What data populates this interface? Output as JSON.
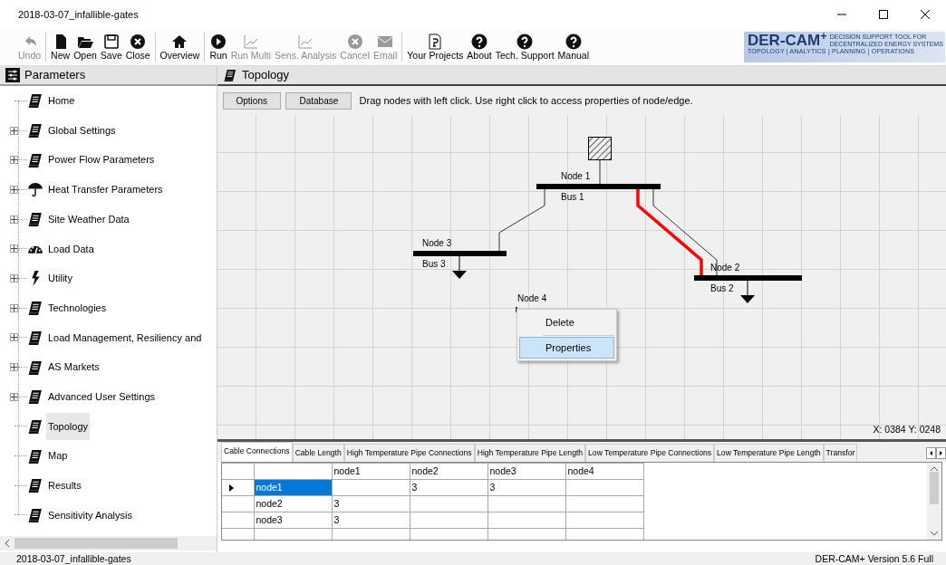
{
  "window": {
    "title": "2018-03-07_infallible-gates"
  },
  "toolbar": [
    [
      {
        "label": "Undo",
        "disabled": true
      }
    ],
    [
      {
        "label": "New",
        "disabled": false
      },
      {
        "label": "Open",
        "disabled": false
      },
      {
        "label": "Save",
        "disabled": false
      },
      {
        "label": "Close",
        "disabled": false
      }
    ],
    [
      {
        "label": "Overview",
        "disabled": false
      }
    ],
    [
      {
        "label": "Run",
        "disabled": false
      },
      {
        "label": "Run Multi",
        "disabled": true
      },
      {
        "label": "Sens. Analysis",
        "disabled": true
      },
      {
        "label": "Cancel",
        "disabled": true
      },
      {
        "label": "Email",
        "disabled": true
      }
    ],
    [
      {
        "label": "Your Projects",
        "disabled": false
      },
      {
        "label": "About",
        "disabled": false
      },
      {
        "label": "Tech. Support",
        "disabled": false
      },
      {
        "label": "Manual",
        "disabled": false
      }
    ]
  ],
  "logo": {
    "title": "DER-CAM$^{+}$",
    "tagline": [
      "DECISION SUPPORT TOOL FOR",
      "DECENTRALIZED ENERGY SYSTEMS"
    ],
    "footer": "TOPOLOGY | ANALYTICS | PLANNING | OPERATIONS"
  },
  "sidebar": {
    "title": "Parameters",
    "items": [
      {
        "label": "Home",
        "expandable": false,
        "selected": false
      },
      {
        "label": "Global Settings",
        "expandable": true,
        "selected": false
      },
      {
        "label": "Power Flow Parameters",
        "expandable": true,
        "selected": false
      },
      {
        "label": "Heat Transfer Parameters",
        "expandable": true,
        "selected": false
      },
      {
        "label": "Site Weather Data",
        "expandable": true,
        "selected": false
      },
      {
        "label": "Load Data",
        "expandable": true,
        "selected": false
      },
      {
        "label": "Utility",
        "expandable": true,
        "selected": false
      },
      {
        "label": "Technologies",
        "expandable": true,
        "selected": false
      },
      {
        "label": "Load Management, Resiliency and",
        "expandable": true,
        "selected": false
      },
      {
        "label": "AS Markets",
        "expandable": true,
        "selected": false
      },
      {
        "label": "Advanced User Settings",
        "expandable": true,
        "selected": false
      },
      {
        "label": "Topology",
        "expandable": false,
        "selected": true
      },
      {
        "label": "Map",
        "expandable": false,
        "selected": false
      },
      {
        "label": "Results",
        "expandable": false,
        "selected": false
      },
      {
        "label": "Sensitivity Analysis",
        "expandable": false,
        "selected": false
      }
    ]
  },
  "topology": {
    "title": "Topology",
    "buttons": [
      "Options",
      "Database"
    ],
    "hint": "Drag nodes with left click. Use right click to access properties of node/edge.",
    "nodes": [
      {
        "label": "Node 1",
        "bus": "Bus 1"
      },
      {
        "label": "Node 3",
        "bus": "Bus 3"
      },
      {
        "label": "Node 2",
        "bus": "Bus 2"
      },
      {
        "label": "Node 4"
      }
    ],
    "edges": [
      {
        "selected": false
      },
      {
        "selected": true
      },
      {
        "selected": false
      }
    ],
    "context_menu": [
      {
        "label": "Delete",
        "selected": false
      },
      {
        "label": "Properties",
        "selected": true
      }
    ],
    "coords": "X: 0384  Y: 0248"
  },
  "bottom_tabs": [
    {
      "label": "Cable Connections",
      "selected": true
    },
    {
      "label": "Cable Length",
      "selected": false
    },
    {
      "label": "High Temperature Pipe Connections",
      "selected": false
    },
    {
      "label": "High Temperature Pipe Length",
      "selected": false
    },
    {
      "label": "Low Temperature Pipe Connections",
      "selected": false
    },
    {
      "label": "Low Temperature Pipe Length",
      "selected": false
    },
    {
      "label": "Transfor",
      "selected": false
    }
  ],
  "table": {
    "columns": [
      "node1",
      "node2",
      "node3",
      "node4"
    ],
    "rows": [
      {
        "label": "node1",
        "selected": true,
        "cells": [
          null,
          "3",
          "3",
          null
        ]
      },
      {
        "label": "node2",
        "selected": false,
        "cells": [
          "3",
          null,
          null,
          null
        ]
      },
      {
        "label": "node3",
        "selected": false,
        "cells": [
          "3",
          null,
          null,
          null
        ]
      }
    ]
  },
  "status_bar": {
    "left": "2018-03-07_infallible-gates",
    "right": "DER-CAM+ Version 5.6 Full"
  }
}
